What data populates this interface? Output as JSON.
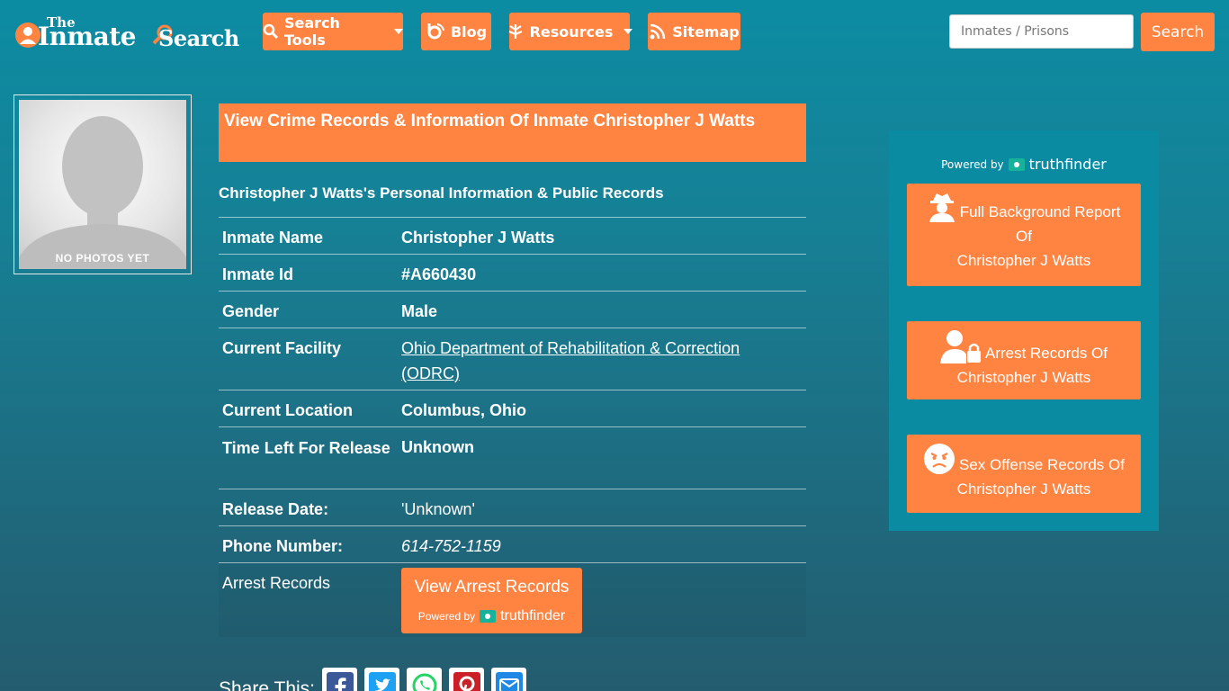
{
  "logo": {
    "the": "The",
    "inmate": "Inmate",
    "search": "Search"
  },
  "nav": {
    "search_tools": "Search Tools",
    "blog": "Blog",
    "resources": "Resources",
    "sitemap": "Sitemap"
  },
  "search": {
    "placeholder": "Inmates / Prisons",
    "button": "Search"
  },
  "photo": {
    "label": "NO PHOTOS YET"
  },
  "main": {
    "title": "View Crime Records & Information Of Inmate Christopher J Watts",
    "subtitle": "Christopher J Watts's Personal Information & Public Records",
    "rows": [
      {
        "key": "Inmate Name",
        "value": "Christopher J Watts"
      },
      {
        "key": "Inmate Id",
        "value": "#A660430"
      },
      {
        "key": "Gender",
        "value": "Male"
      },
      {
        "key": "Current Facility",
        "value": "Ohio Department of Rehabilitation & Correction (ODRC)"
      },
      {
        "key": "Current Location",
        "value": "Columbus, Ohio"
      },
      {
        "key": "Time Left For Release",
        "value": "Unknown"
      },
      {
        "key": "Release Date:",
        "value": "'Unknown'"
      },
      {
        "key": "Phone Number:",
        "value": "614-752-1159"
      },
      {
        "key": "Arrest Records",
        "value": "View Arrest Records"
      }
    ],
    "arrest_powered": "Powered by",
    "arrest_brand": "truthfinder"
  },
  "share": {
    "label": "Share This:"
  },
  "sidebar": {
    "powered": "Powered by",
    "brand": "truthfinder",
    "buttons": [
      {
        "line1": "Full Background Report",
        "line2": "Of",
        "line3": "Christopher J Watts"
      },
      {
        "line1": "Arrest Records Of",
        "line2": "Christopher J Watts"
      },
      {
        "line1": "Sex Offense Records Of",
        "line2": "Christopher J Watts"
      }
    ]
  },
  "colors": {
    "accent": "#ff8442",
    "background": "#177f94",
    "sidebar": "#0b8ba1"
  }
}
